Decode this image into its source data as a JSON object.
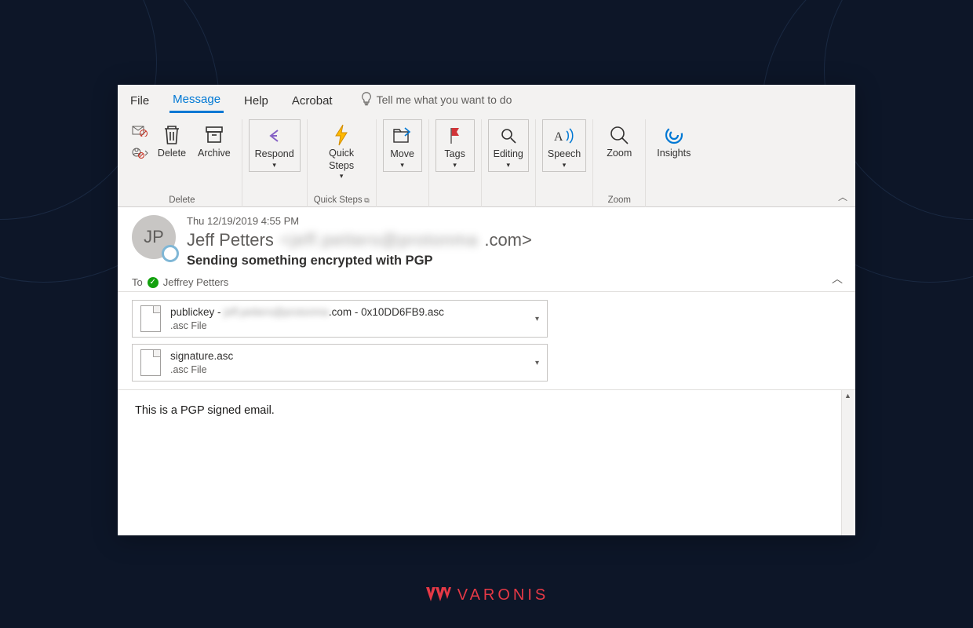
{
  "tabs": {
    "file": "File",
    "message": "Message",
    "help": "Help",
    "acrobat": "Acrobat",
    "tell_me": "Tell me what you want to do"
  },
  "ribbon": {
    "delete_group": "Delete",
    "delete": "Delete",
    "archive": "Archive",
    "respond": "Respond",
    "quick_steps": "Quick\nSteps",
    "quick_steps_group": "Quick Steps",
    "move": "Move",
    "tags": "Tags",
    "editing": "Editing",
    "speech": "Speech",
    "zoom": "Zoom",
    "zoom_group": "Zoom",
    "insights": "Insights"
  },
  "email": {
    "timestamp": "Thu 12/19/2019 4:55 PM",
    "initials": "JP",
    "sender_name": "Jeff Petters",
    "sender_addr_blur": "<jeff.petters@protonma",
    "sender_addr_tail": ".com>",
    "subject": "Sending something encrypted with PGP",
    "to_label": "To",
    "to_name": "Jeffrey Petters"
  },
  "attachments": [
    {
      "name_prefix": "publickey - ",
      "name_blur": "jeff.petters@protonma",
      "name_suffix": ".com - 0x10DD6FB9.asc",
      "subtype": ".asc File"
    },
    {
      "name_prefix": "signature.asc",
      "name_blur": "",
      "name_suffix": "",
      "subtype": ".asc File"
    }
  ],
  "body": "This is a PGP signed email.",
  "brand": "VARONIS"
}
